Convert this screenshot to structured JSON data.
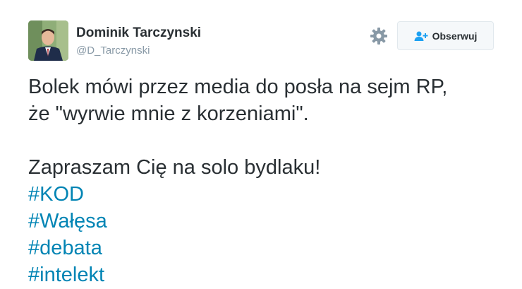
{
  "user": {
    "name": "Dominik Tarczynski",
    "handle": "@D_Tarczynski"
  },
  "actions": {
    "settings_icon": "gear-icon",
    "follow_label": "Obserwuj",
    "follow_icon": "add-user-icon"
  },
  "tweet": {
    "lines": [
      "Bolek mówi przez media do posła na sejm RP,",
      "że \"wyrwie mnie z korzeniami\"."
    ],
    "second_paragraph": "Zapraszam Cię na solo bydlaku!",
    "hashtags": [
      "#KOD",
      "#Wałęsa",
      "#debata",
      "#intelekt"
    ]
  },
  "colors": {
    "hashtag": "#0084b4",
    "text": "#292f33",
    "handle": "#8899a6",
    "follow_icon": "#1da1f2"
  }
}
